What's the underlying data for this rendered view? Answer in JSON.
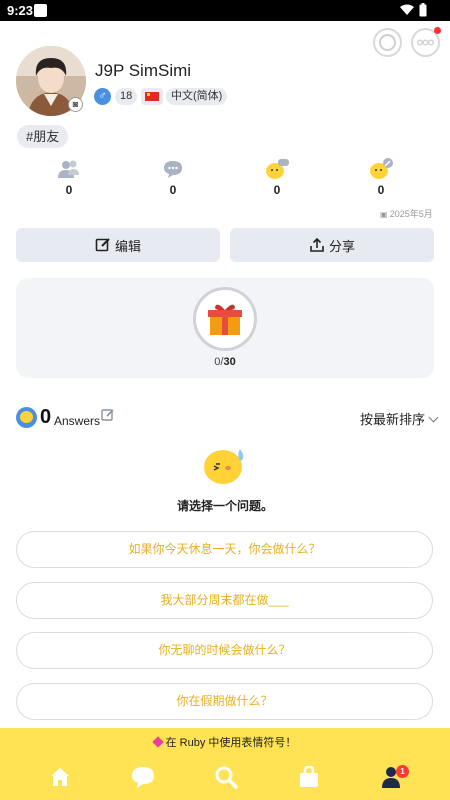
{
  "status_bar": {
    "time": "9:23"
  },
  "profile": {
    "username": "J9P SimSimi",
    "age": "18",
    "language": "中文(简体)",
    "hashtag": "#朋友"
  },
  "stats": [
    {
      "icon": "friends-icon",
      "value": "0"
    },
    {
      "icon": "chat-icon",
      "value": "0"
    },
    {
      "icon": "chick-chat-icon",
      "value": "0"
    },
    {
      "icon": "chick-edit-icon",
      "value": "0"
    }
  ],
  "join_date": "2025年5月",
  "actions": {
    "edit_label": "编辑",
    "share_label": "分享"
  },
  "gifts": {
    "current": "0",
    "separator": "/",
    "total": "30"
  },
  "answers": {
    "count": "0",
    "label": "Answers",
    "sort_label": "按最新排序"
  },
  "empty_prompt": "请选择一个问题。",
  "questions": [
    "如果你今天休息一天，你会做什么？",
    "我大部分周末都在做___",
    "你无聊的时候会做什么？",
    "你在假期做什么？"
  ],
  "banner": "在 Ruby 中使用表情符号！",
  "nav": {
    "badge": "1"
  },
  "colors": {
    "accent_yellow": "#ffe355",
    "question_text": "#e8b020",
    "badge_red": "#ff3b30"
  }
}
